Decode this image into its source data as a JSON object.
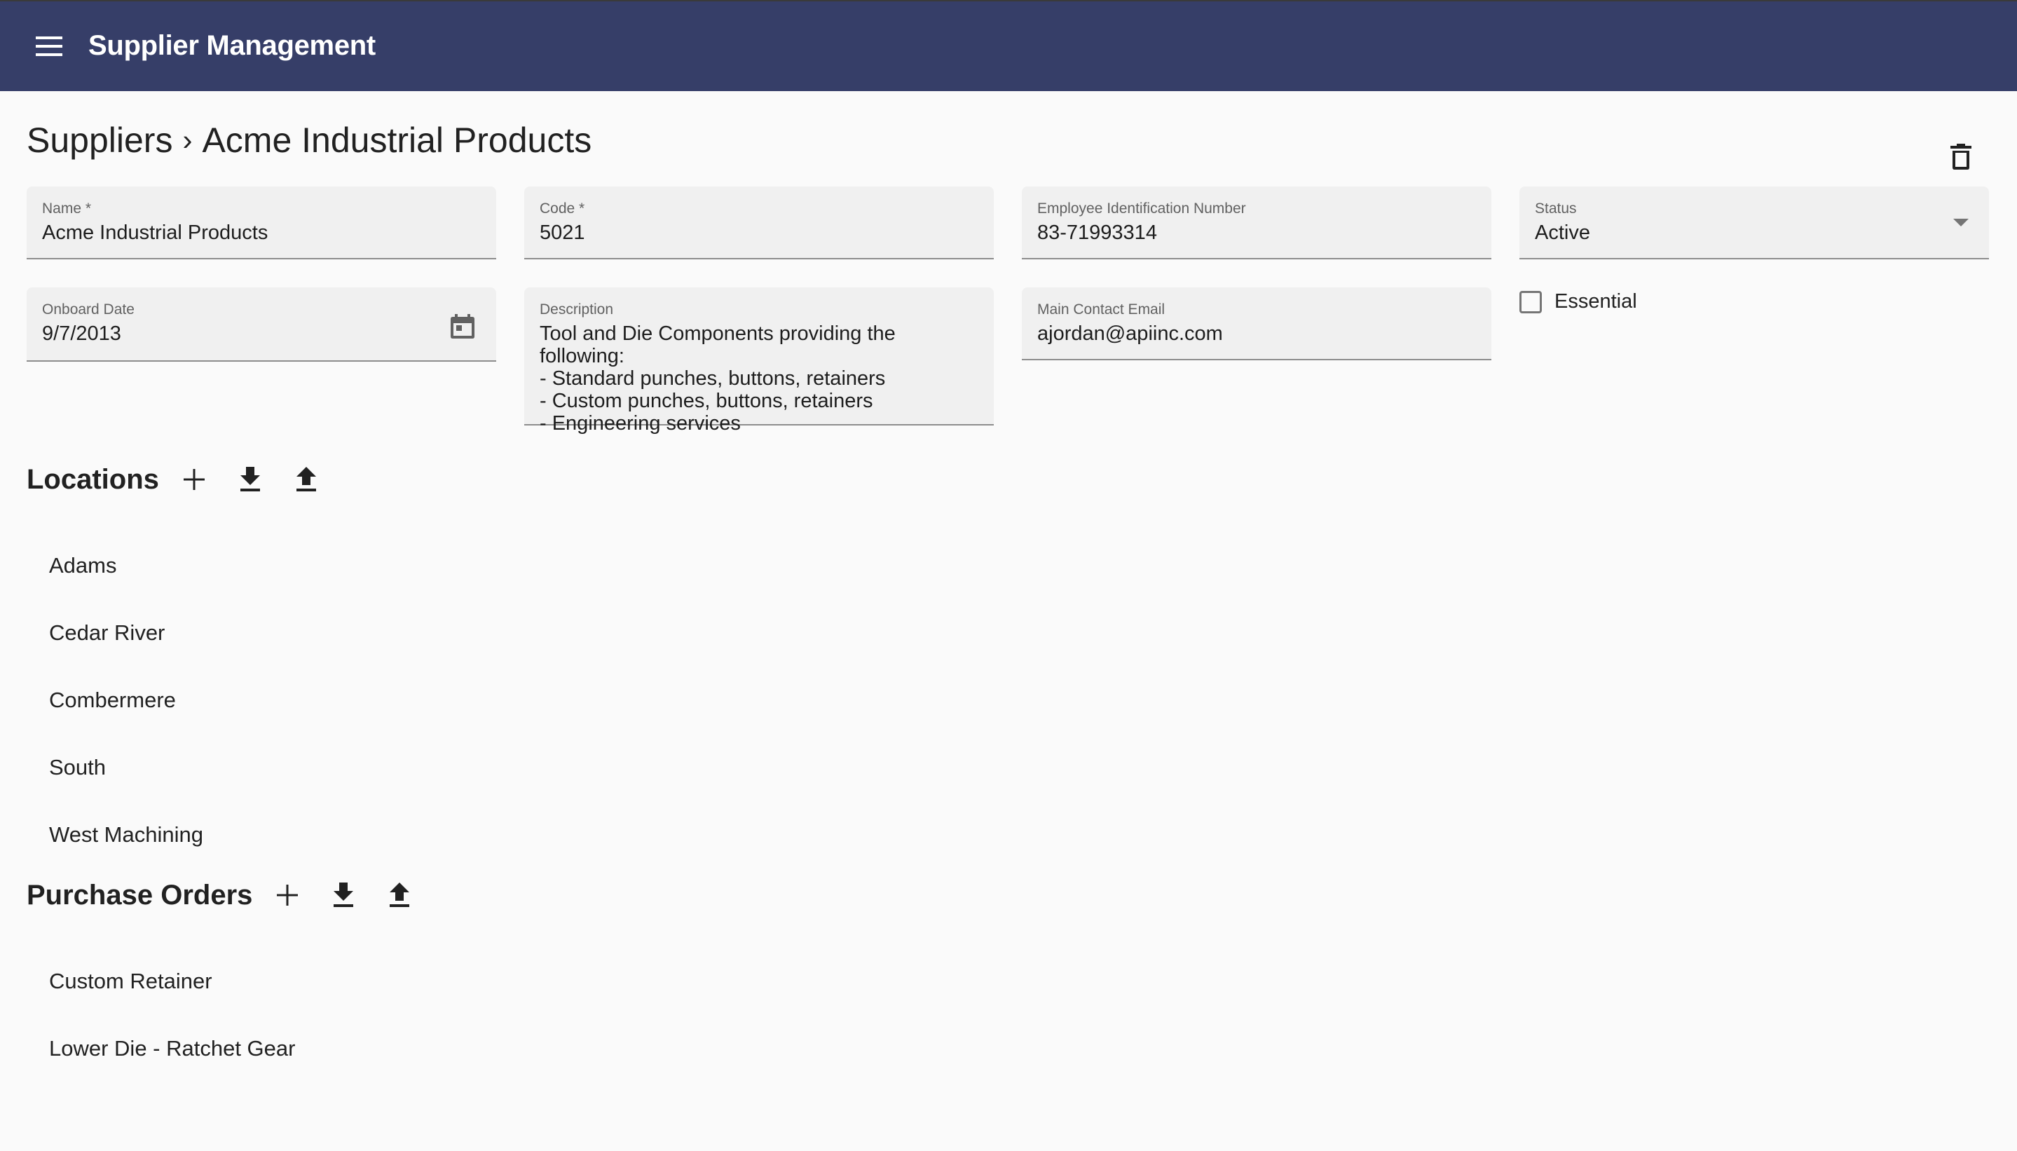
{
  "app": {
    "title": "Supplier Management",
    "menu_icon": "menu-icon",
    "colors": {
      "appbar": "#363e68",
      "background": "#fafafa",
      "field_bg": "#f0f0f0",
      "text": "#212121"
    }
  },
  "breadcrumb": {
    "parent": "Suppliers",
    "separator": "›",
    "current": "Acme Industrial Products"
  },
  "actions": {
    "delete_icon": "trash-icon"
  },
  "form": {
    "name": {
      "label": "Name *",
      "value": "Acme Industrial Products"
    },
    "code": {
      "label": "Code *",
      "value": "5021"
    },
    "ein": {
      "label": "Employee Identification Number",
      "value": "83-71993314"
    },
    "status": {
      "label": "Status",
      "value": "Active",
      "icon": "dropdown-arrow-icon"
    },
    "onboard_date": {
      "label": "Onboard Date",
      "value": "9/7/2013",
      "icon": "calendar-icon"
    },
    "description": {
      "label": "Description",
      "value": "Tool and Die Components providing the following:\n- Standard punches, buttons, retainers\n- Custom punches, buttons, retainers\n- Engineering services"
    },
    "email": {
      "label": "Main Contact Email",
      "value": "ajordan@apiinc.com"
    },
    "essential": {
      "label": "Essential",
      "checked": false
    }
  },
  "locations": {
    "title": "Locations",
    "icons": [
      "add-icon",
      "download-icon",
      "upload-icon"
    ],
    "items": [
      "Adams",
      "Cedar River",
      "Combermere",
      "South",
      "West Machining"
    ]
  },
  "purchase_orders": {
    "title": "Purchase Orders",
    "icons": [
      "add-icon",
      "download-icon",
      "upload-icon"
    ],
    "items": [
      "Custom Retainer",
      "Lower Die - Ratchet Gear"
    ]
  }
}
